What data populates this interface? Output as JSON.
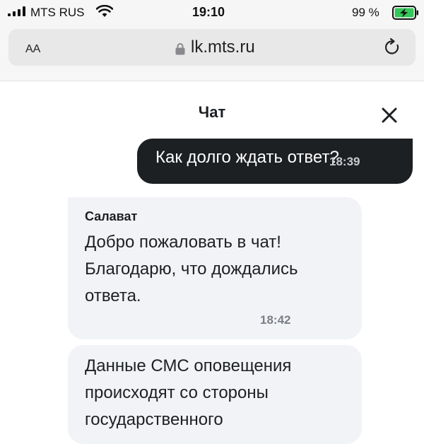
{
  "status_bar": {
    "carrier": "MTS RUS",
    "time": "19:10",
    "battery_percent": "99 %",
    "signal_icon": "signal-icon",
    "wifi_icon": "wifi-icon",
    "battery_icon": "battery-charging-icon"
  },
  "browser": {
    "text_size_label": "AA",
    "url": "lk.mts.ru",
    "lock_icon": "lock-icon",
    "reload_icon": "reload-icon"
  },
  "chat": {
    "title": "Чат",
    "close_icon": "close-icon",
    "messages": [
      {
        "direction": "outgoing",
        "text": "Как долго ждать ответ?",
        "time": "18:39"
      },
      {
        "direction": "incoming",
        "sender": "Салават",
        "lines": [
          "Добро пожаловать в чат!",
          "Благодарю, что дождались",
          "ответа."
        ],
        "time": "18:42"
      },
      {
        "direction": "incoming",
        "lines": [
          "Данные СМС оповещения",
          "происходят со стороны",
          "государственного"
        ]
      }
    ]
  },
  "colors": {
    "outgoing_bubble": "#1d2023",
    "incoming_bubble": "#f2f3f7",
    "battery_charging": "#34c759"
  }
}
